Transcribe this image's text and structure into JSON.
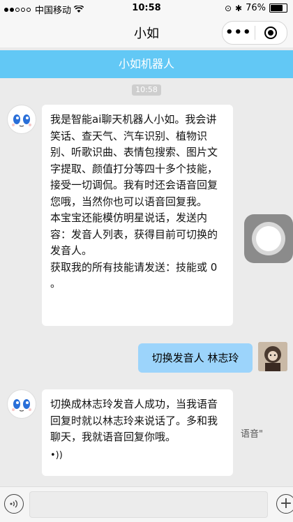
{
  "status_bar": {
    "carrier": "中国移动",
    "time": "10:58",
    "battery": "76%",
    "battery_level": 0.76
  },
  "title_bar": {
    "title": "小如",
    "more_icon": "more-dots-icon",
    "close_icon": "record-circle-icon"
  },
  "banner": {
    "title": "小如机器人"
  },
  "chat": {
    "time_chip": "10:58",
    "bot_message_1": [
      "我是智能ai聊天机器人小如。我会讲笑话、查天气、汽车识别、植物识别、听歌识曲、表情包搜索、图片文字提取、颜值打分等四十多个技能，接受一切调侃。我有时还会语音回复您哦，当然你也可以语音回复我。",
      "本宝宝还能模仿明星说话，发送内容：发音人列表，获得目前可切换的发音人。",
      "获取我的所有技能请发送：技能或 0 。"
    ],
    "user_message": "切换发音人 林志玲",
    "bot_message_2": "切换成林志玲发音人成功，当我语音回复时就以林志玲来说话了。多和我聊天，我就语音回复你哦。",
    "side_text": "语音\""
  },
  "input_bar": {
    "voice_icon": "voice-icon",
    "plus_icon": "plus-icon",
    "placeholder": ""
  }
}
